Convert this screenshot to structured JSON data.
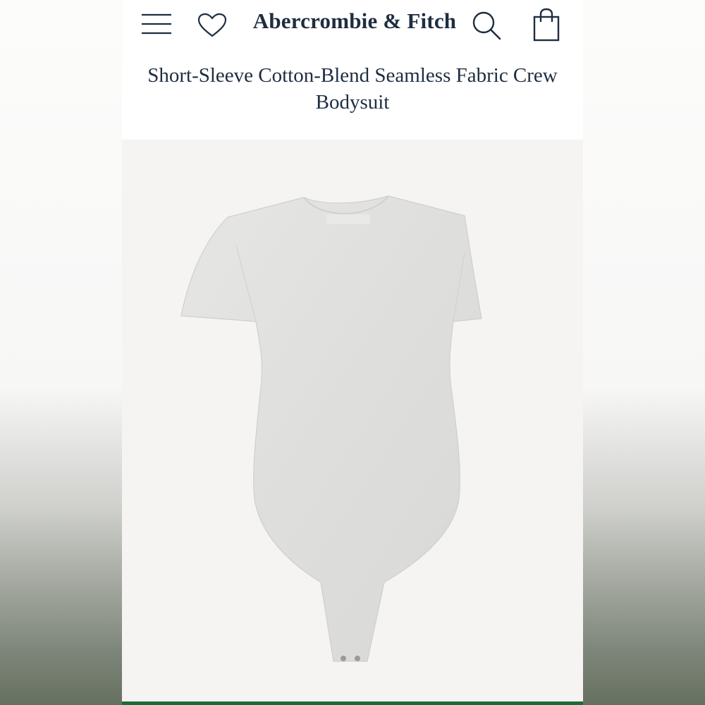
{
  "header": {
    "brand": "Abercrombie & Fitch",
    "icons": {
      "menu": "menu-icon",
      "wishlist": "heart-icon",
      "search": "search-icon",
      "bag": "shopping-bag-icon"
    },
    "ink_color": "#1e2e40"
  },
  "product": {
    "title": "Short-Sleeve Cotton-Blend Seamless Fabric Crew Bodysuit",
    "image": {
      "description_icon": "product-photo",
      "garment_color": "#e2e2e0"
    }
  },
  "footer": {
    "accent_color": "#1f6b35"
  }
}
